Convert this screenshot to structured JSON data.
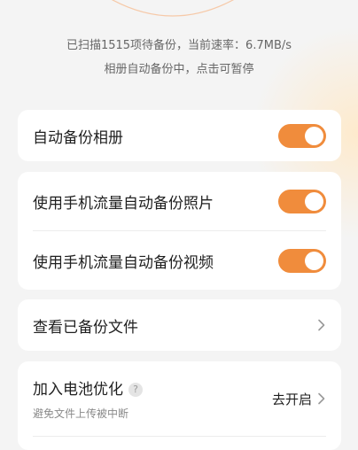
{
  "status": {
    "line1": "已扫描1515项待备份，当前速率：6.7MB/s",
    "line2": "相册自动备份中，点击可暂停"
  },
  "settings": {
    "auto_backup": {
      "label": "自动备份相册",
      "enabled": true
    },
    "mobile_photos": {
      "label": "使用手机流量自动备份照片",
      "enabled": true
    },
    "mobile_videos": {
      "label": "使用手机流量自动备份视频",
      "enabled": true
    },
    "view_backups": {
      "label": "查看已备份文件"
    },
    "battery": {
      "label": "加入电池优化",
      "help": "?",
      "subtitle": "避免文件上传被中断",
      "action": "去开启"
    }
  },
  "icons": {
    "chevron": "chevron-right-icon",
    "help": "question-circle-icon"
  },
  "colors": {
    "accent": "#f08c3c",
    "background": "#f4f4f4",
    "card": "#ffffff"
  }
}
